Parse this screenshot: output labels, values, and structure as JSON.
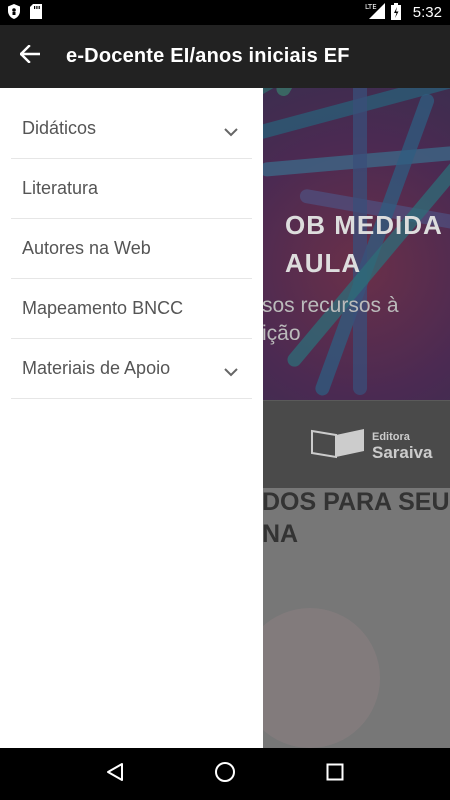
{
  "status_bar": {
    "time": "5:32",
    "network": "LTE",
    "icons": [
      "shield-icon",
      "sd-card-icon",
      "signal-icon",
      "battery-icon"
    ]
  },
  "app_bar": {
    "title": "e-Docente EI/anos iniciais EF",
    "back_icon": "arrow-back-icon"
  },
  "drawer": {
    "items": [
      {
        "label": "Didáticos",
        "expandable": true
      },
      {
        "label": "Literatura",
        "expandable": false
      },
      {
        "label": "Autores na Web",
        "expandable": false
      },
      {
        "label": "Mapeamento BNCC",
        "expandable": false
      },
      {
        "label": "Materiais de Apoio",
        "expandable": true
      }
    ]
  },
  "background": {
    "hero_line1": "OB MEDIDA",
    "hero_line2": "AULA",
    "hero_sub1": "sos recursos à",
    "hero_sub2": "ição",
    "brand_small": "Editora",
    "brand_big": "Saraiva",
    "section_line1": "DOS PARA SEU",
    "section_line2": "NA"
  },
  "nav_bar": {
    "buttons": [
      "back-triangle-icon",
      "home-circle-icon",
      "recents-square-icon"
    ]
  },
  "colors": {
    "app_bar": "#222222",
    "drawer": "#ffffff",
    "menu_text": "#555555",
    "divider": "#e6e6e6"
  }
}
